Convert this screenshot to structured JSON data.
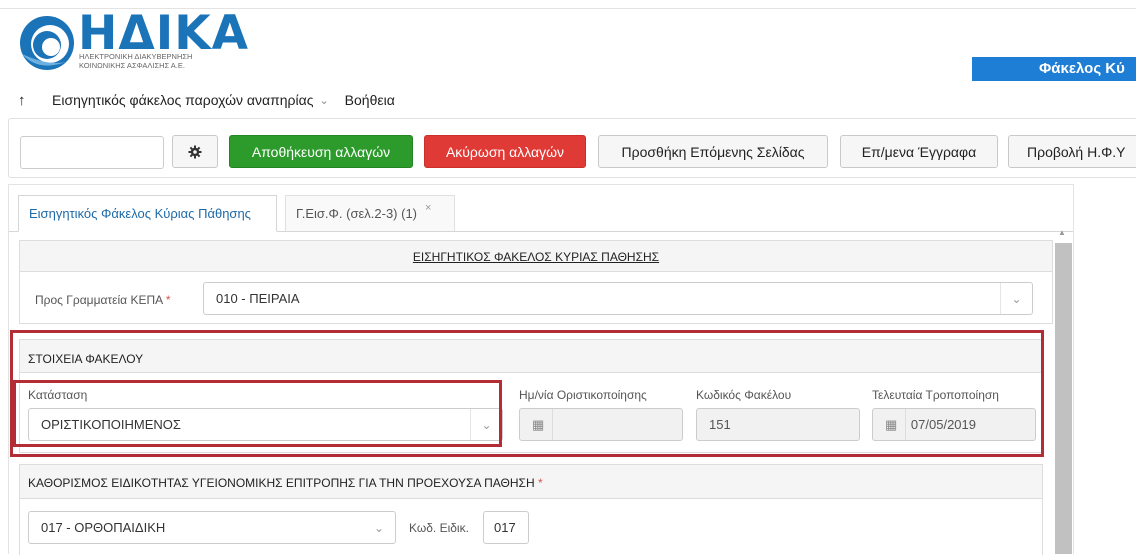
{
  "logo": {
    "title": "ΗΔΙΚΑ",
    "subtitle_line1": "ΗΛΕΚΤΡΟΝΙΚΗ ΔΙΑΚΥΒΕΡΝΗΣΗ",
    "subtitle_line2": "ΚΟΙΝΩΝΙΚΗΣ ΑΣΦΑΛΙΣΗΣ Α.Ε."
  },
  "header": {
    "title": "Φάκελος Κύ"
  },
  "menu": {
    "up_icon": "↑",
    "items": [
      {
        "label": "Εισηγητικός φάκελος παροχών αναπηρίας",
        "has_dropdown": true
      },
      {
        "label": "Βοήθεια",
        "has_dropdown": false
      }
    ]
  },
  "toolbar": {
    "search_value": "",
    "settings_icon": "gear-icon",
    "save_label": "Αποθήκευση αλλαγών",
    "cancel_label": "Ακύρωση αλλαγών",
    "add_next_page_label": "Προσθήκη Επόμενης Σελίδας",
    "next_docs_label": "Επ/μενα Έγγραφα",
    "view_label": "Προβολή Η.Φ.Υ"
  },
  "tabs": [
    {
      "label": "Εισηγητικός Φάκελος Κύριας Πάθησης",
      "active": true
    },
    {
      "label": "Γ.Εισ.Φ. (σελ.2-3) (1)",
      "active": false,
      "close": "×"
    }
  ],
  "form": {
    "main_title": "ΕΙΣΗΓΗΤΙΚΟΣ ΦΑΚΕΛΟΣ ΚΥΡΙΑΣ ΠΑΘΗΣΗΣ",
    "secretariat": {
      "label": "Προς Γραμματεία ΚΕΠΑ",
      "required_mark": "*",
      "value": "010 - ΠΕΙΡΑΙΑ"
    },
    "folder_section": {
      "title": "ΣΤΟΙΧΕΙΑ ΦΑΚΕΛΟΥ",
      "status": {
        "label": "Κατάσταση",
        "value": "ΟΡΙΣΤΙΚΟΠΟΙΗΜΕΝΟΣ"
      },
      "finalization_date": {
        "label": "Ημ/νία Οριστικοποίησης",
        "value": ""
      },
      "folder_code": {
        "label": "Κωδικός Φακέλου",
        "value": "151"
      },
      "last_modified": {
        "label": "Τελευταία Τροποποίηση",
        "value": "07/05/2019"
      }
    },
    "specialty_section": {
      "title": "ΚΑΘΟΡΙΣΜΟΣ ΕΙΔΙΚΟΤΗΤΑΣ ΥΓΕΙΟΝΟΜΙΚΗΣ ΕΠΙΤΡΟΠΗΣ ΓΙΑ ΤΗΝ ΠΡΟΕΧΟΥΣΑ ΠΑΘΗΣΗ",
      "required_mark": "*",
      "specialty_value": "017 - ΟΡΘΟΠΑΙΔΙΚΗ",
      "code_label": "Κωδ. Ειδικ.",
      "code_value": "017"
    }
  },
  "colors": {
    "brand_blue": "#1b74b8",
    "title_bar": "#1e7ed6",
    "save_green": "#2c9b2c",
    "cancel_red": "#df3a36",
    "highlight_red": "#b32d37",
    "required_red": "#d9534f"
  }
}
